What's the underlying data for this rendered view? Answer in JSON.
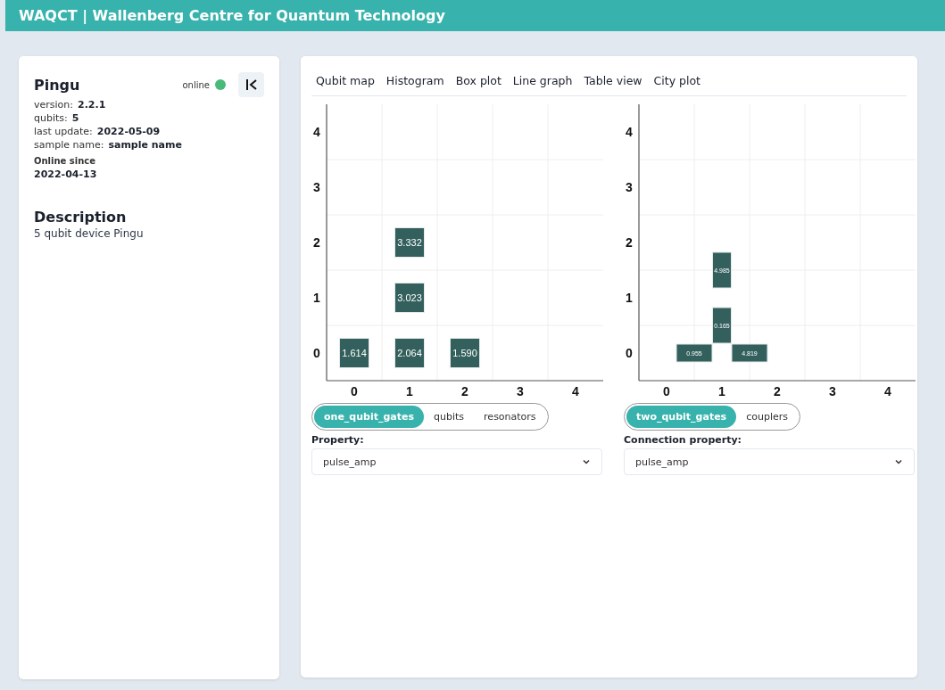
{
  "header": {
    "title": "WAQCT | Wallenberg Centre for Quantum Technology"
  },
  "device": {
    "name": "Pingu",
    "status": "online",
    "online": true,
    "details": [
      {
        "label": "version:",
        "value": "2.2.1"
      },
      {
        "label": "qubits:",
        "value": "5"
      },
      {
        "label": "last update:",
        "value": "2022-05-09"
      },
      {
        "label": "sample name:",
        "value": "sample name"
      }
    ],
    "online_since_label": "Online since",
    "online_since": "2022-04-13",
    "description_title": "Description",
    "description": "5 qubit device Pingu"
  },
  "tabs": [
    "Qubit map",
    "Histogram",
    "Box plot",
    "Line graph",
    "Table view",
    "City plot"
  ],
  "maps": [
    {
      "column_labels": [
        "0",
        "1",
        "2",
        "3",
        "4"
      ],
      "rows": [
        {
          "label": "4",
          "cells": [
            null,
            null,
            null,
            null,
            null
          ]
        },
        {
          "label": "3",
          "cells": [
            null,
            null,
            null,
            null,
            null
          ]
        },
        {
          "label": "2",
          "cells": [
            null,
            {
              "value": "3.332"
            },
            null,
            null,
            null
          ]
        },
        {
          "label": "1",
          "cells": [
            null,
            {
              "value": "3.023"
            },
            null,
            null,
            null
          ]
        },
        {
          "label": "0",
          "cells": [
            {
              "value": "1.614"
            },
            {
              "value": "2.064"
            },
            {
              "value": "1.590"
            },
            null,
            null
          ]
        }
      ],
      "toggle": [
        {
          "label": "one_qubit_gates",
          "selected": true
        },
        {
          "label": "qubits",
          "selected": false
        },
        {
          "label": "resonators",
          "selected": false
        }
      ],
      "select_label": "Property:",
      "select_value": "pulse_amp"
    },
    {
      "column_labels": [
        "0",
        "1",
        "2",
        "3",
        "4"
      ],
      "rows": [
        {
          "label": "4",
          "cells": [
            null,
            null,
            null,
            null,
            null
          ]
        },
        {
          "label": "3",
          "cells": [
            null,
            null,
            null,
            null,
            null
          ]
        },
        {
          "label": "2",
          "cells": [
            null,
            null,
            null,
            null,
            null
          ]
        },
        {
          "label": "1",
          "cells": [
            null,
            {
              "up_link": "4.985"
            },
            null,
            null,
            null
          ]
        },
        {
          "label": "0",
          "cells": [
            {
              "right_link": "0.955"
            },
            {
              "right_link": "4.819",
              "up_link": "0.165"
            },
            null,
            null,
            null
          ]
        }
      ],
      "toggle": [
        {
          "label": "two_qubit_gates",
          "selected": true
        },
        {
          "label": "couplers",
          "selected": false
        }
      ],
      "select_label": "Connection property:",
      "select_value": "pulse_amp"
    }
  ]
}
